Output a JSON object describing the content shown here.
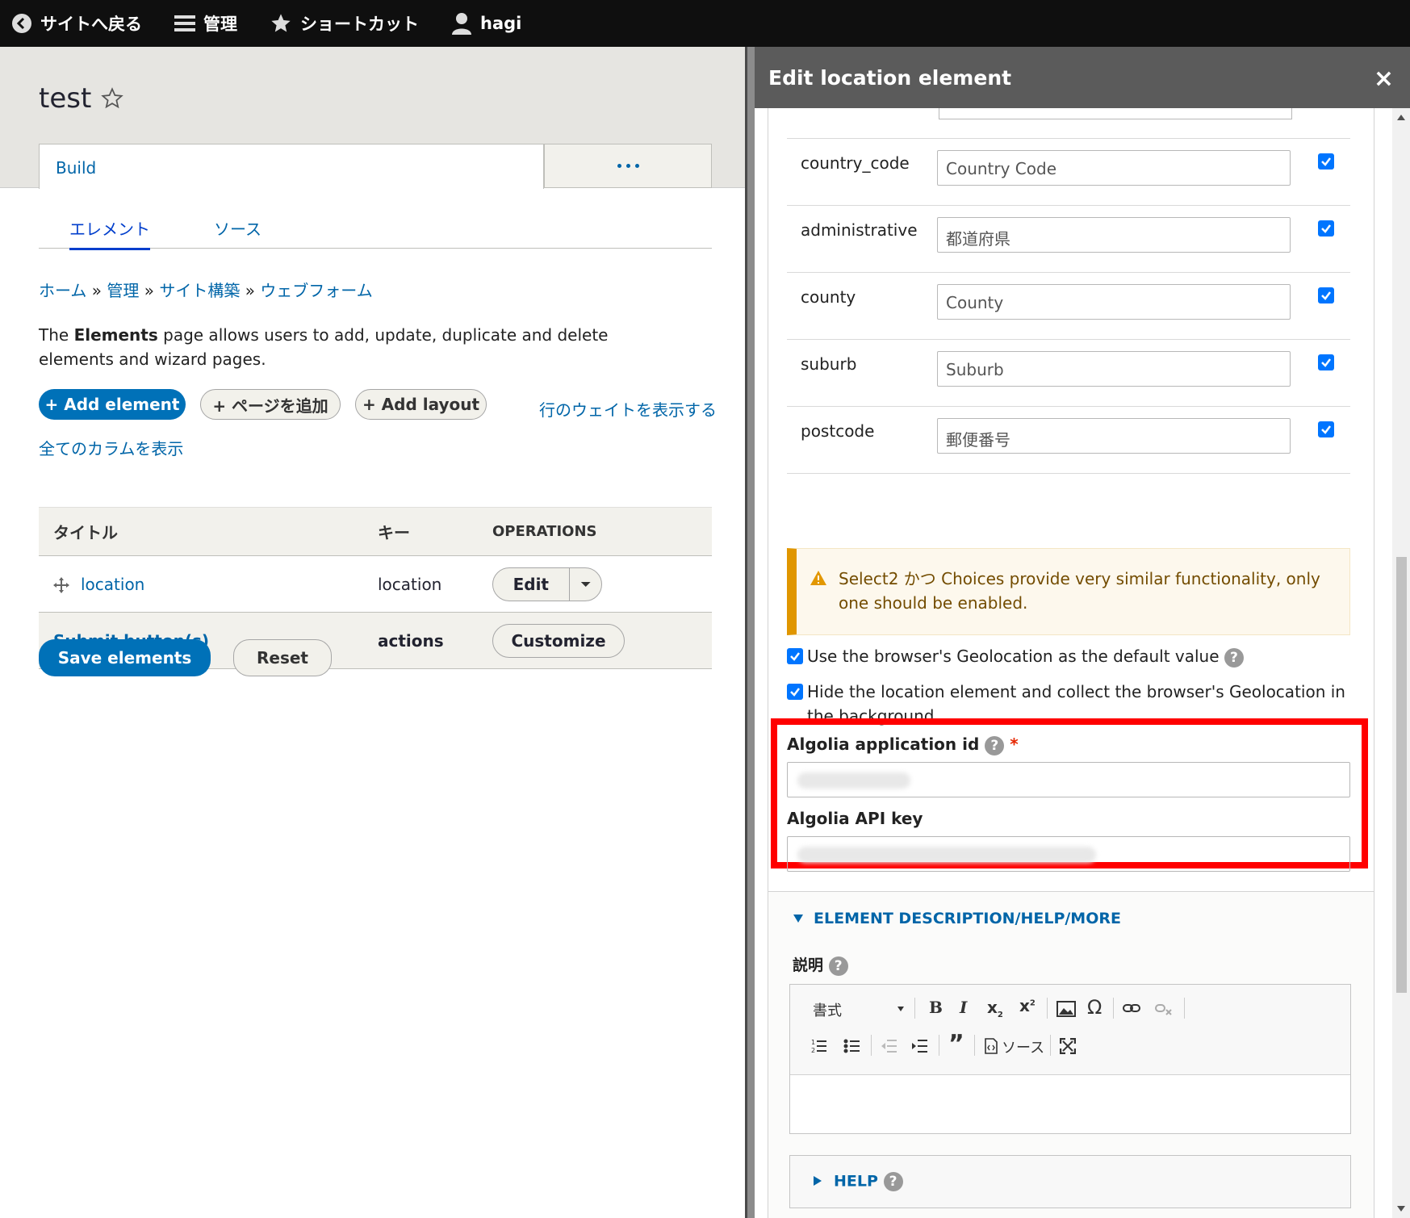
{
  "toolbar": {
    "back": "サイトへ戻る",
    "manage": "管理",
    "shortcuts": "ショートカット",
    "user": "hagi"
  },
  "page": {
    "title": "test",
    "primary_tab": "Build",
    "secondary_tabs": [
      "エレメント",
      "ソース"
    ],
    "breadcrumb": [
      "ホーム",
      "管理",
      "サイト構築",
      "ウェブフォーム"
    ],
    "breadcrumb_sep": "»",
    "description_pre": "The ",
    "description_bold": "Elements",
    "description_post": " page allows users to add, update, duplicate and delete elements and wizard pages.",
    "buttons": {
      "add_element": "+ Add element",
      "add_page": "+ ページを追加",
      "add_layout": "+ Add layout",
      "show_weights": "行のウェイトを表示する",
      "show_all_columns": "全てのカラムを表示",
      "save": "Save elements",
      "reset": "Reset"
    },
    "table": {
      "headers": [
        "タイトル",
        "キー",
        "OPERATIONS"
      ],
      "rows": [
        {
          "title": "location",
          "key": "location",
          "op": "Edit"
        },
        {
          "title": "Submit button(s)",
          "key": "actions",
          "op": "Customize"
        }
      ]
    }
  },
  "dialog": {
    "title": "Edit location element",
    "close": "×",
    "fields": [
      {
        "name": "country_code",
        "value": "Country Code",
        "checked": true
      },
      {
        "name": "administrative",
        "value": "都道府県",
        "checked": true
      },
      {
        "name": "county",
        "value": "County",
        "checked": true
      },
      {
        "name": "suburb",
        "value": "Suburb",
        "checked": true
      },
      {
        "name": "postcode",
        "value": "郵便番号",
        "checked": true
      }
    ],
    "warning": "Select2 かつ Choices provide very similar functionality, only one should be enabled.",
    "options": {
      "geolocation_default": "Use the browser's Geolocation as the default value",
      "hide_location": "Hide the location element and collect the browser's Geolocation in the background"
    },
    "algolia_app_id_label": "Algolia application id",
    "required_mark": "*",
    "algolia_api_key_label": "Algolia API key",
    "help_q": "?",
    "section_description": "ELEMENT DESCRIPTION/HELP/MORE",
    "description_label": "説明",
    "editor": {
      "format": "書式",
      "source": "ソース"
    },
    "help_section": "HELP"
  },
  "colors": {
    "toolbar": "#0f0f0f",
    "primary": "#0071b8",
    "link": "#0065a8",
    "highlight": "#ff0000"
  }
}
